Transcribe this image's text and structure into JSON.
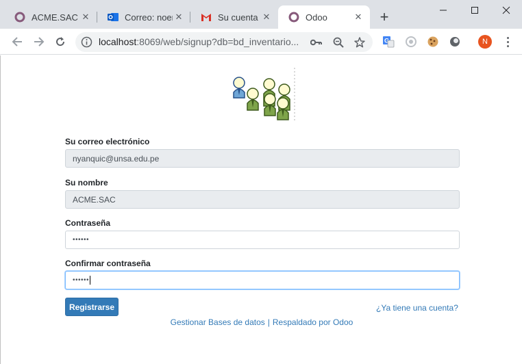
{
  "browser": {
    "tabs": [
      {
        "title": "ACME.SAC -",
        "icon": "odoo-icon"
      },
      {
        "title": "Correo: noen",
        "icon": "outlook-icon"
      },
      {
        "title": "Su cuenta de",
        "icon": "gmail-icon"
      },
      {
        "title": "Odoo",
        "icon": "odoo-icon"
      }
    ],
    "url_host": "localhost",
    "url_rest": ":8069/web/signup?db=bd_inventario...",
    "profile_initial": "N"
  },
  "form": {
    "email_label": "Su correo electrónico",
    "email_value": "nyanquic@unsa.edu.pe",
    "name_label": "Su nombre",
    "name_value": "ACME.SAC",
    "password_label": "Contraseña",
    "password_value": "••••••",
    "confirm_label": "Confirmar contraseña",
    "confirm_value": "••••••",
    "submit_label": "Registrarse",
    "login_link": "¿Ya tiene una cuenta?"
  },
  "footer": {
    "manage_db": "Gestionar Bases de datos",
    "separator": "|",
    "powered_by": "Respaldado por Odoo"
  },
  "colors": {
    "primary": "#337ab7",
    "tab_strip": "#dee1e6",
    "odoo": "#875a7b",
    "avatar": "#e8541f"
  }
}
